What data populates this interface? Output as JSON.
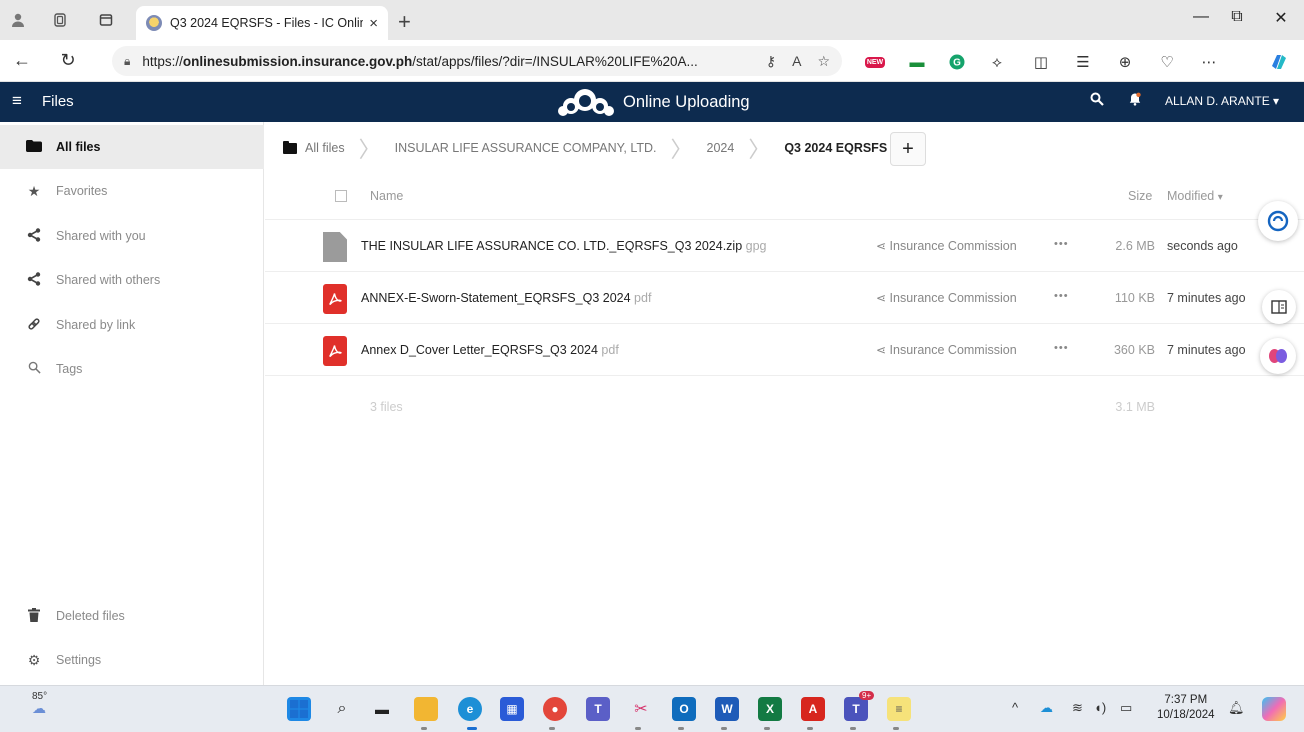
{
  "browser": {
    "tab_title": "Q3 2024 EQRSFS - Files - IC Onlin",
    "tab_close": "×",
    "new_tab": "+",
    "url_prefix": "https://",
    "url_domain": "onlinesubmission.insurance.gov.ph",
    "url_path": "/stat/apps/files/?dir=/INSULAR%20LIFE%20A...",
    "new_badge": "NEW",
    "win_minimize": "—",
    "win_restore": "⧉",
    "win_close": "✕"
  },
  "header": {
    "menu_label": "Files",
    "brand_text": "Online Uploading",
    "user_name": "ALLAN D. ARANTE"
  },
  "sidebar": {
    "items": [
      {
        "label": "All files",
        "icon": "folder-icon",
        "active": true
      },
      {
        "label": "Favorites",
        "icon": "star-icon"
      },
      {
        "label": "Shared with you",
        "icon": "share-icon"
      },
      {
        "label": "Shared with others",
        "icon": "share-icon"
      },
      {
        "label": "Shared by link",
        "icon": "link-icon"
      },
      {
        "label": "Tags",
        "icon": "search-icon"
      }
    ],
    "bottom": [
      {
        "label": "Deleted files",
        "icon": "trash-icon"
      },
      {
        "label": "Settings",
        "icon": "gear-icon"
      }
    ]
  },
  "breadcrumb": [
    "All files",
    "INSULAR LIFE ASSURANCE COMPANY, LTD.",
    "2024",
    "Q3 2024 EQRSFS"
  ],
  "table": {
    "col_name": "Name",
    "col_size": "Size",
    "col_modified": "Modified",
    "rows": [
      {
        "name": "THE INSULAR LIFE ASSURANCE CO. LTD._EQRSFS_Q3 2024.zip",
        "ext": "gpg",
        "type": "generic",
        "shared_with": "Insurance Commission",
        "size": "2.6 MB",
        "modified": "seconds ago"
      },
      {
        "name": "ANNEX-E-Sworn-Statement_EQRSFS_Q3 2024",
        "ext": "pdf",
        "type": "pdf",
        "shared_with": "Insurance Commission",
        "size": "110 KB",
        "modified": "7 minutes ago"
      },
      {
        "name": "Annex D_Cover Letter_EQRSFS_Q3 2024",
        "ext": "pdf",
        "type": "pdf",
        "shared_with": "Insurance Commission",
        "size": "360 KB",
        "modified": "7 minutes ago"
      }
    ],
    "summary_count": "3 files",
    "summary_size": "3.1 MB",
    "actions_label": "•••"
  },
  "taskbar": {
    "temperature": "85°",
    "time": "7:37 PM",
    "date": "10/18/2024",
    "teams_badge": "9+"
  },
  "colors": {
    "header_bg": "#0d2b4f",
    "pdf_red": "#e0302a",
    "active_item_bg": "#ebebeb"
  }
}
